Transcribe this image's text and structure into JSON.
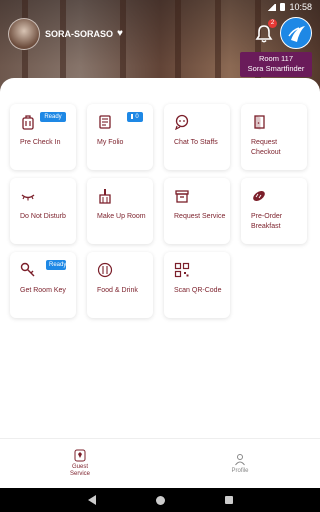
{
  "statusbar": {
    "time": "10:58"
  },
  "header": {
    "hotel_name": "SORA-SORASO",
    "notification_count": "2",
    "room_label": "Room 117",
    "room_sub": "Sora Smartfinder"
  },
  "services": [
    {
      "label": "Pre Check In",
      "icon": "luggage-icon",
      "badge": "Ready"
    },
    {
      "label": "My Folio",
      "icon": "receipt-icon",
      "badge": "0"
    },
    {
      "label": "Chat To Staffs",
      "icon": "chat-icon"
    },
    {
      "label": "Request Checkout",
      "icon": "door-icon"
    },
    {
      "label": "Do Not Disturb",
      "icon": "closed-eye-icon"
    },
    {
      "label": "Make Up Room",
      "icon": "broom-icon"
    },
    {
      "label": "Request Service",
      "icon": "service-box-icon"
    },
    {
      "label": "Pre-Order Breakfast",
      "icon": "bread-icon"
    },
    {
      "label": "Get Room Key",
      "icon": "key-icon",
      "badge": "Ready"
    },
    {
      "label": "Food & Drink",
      "icon": "cutlery-icon"
    },
    {
      "label": "Scan QR-Code",
      "icon": "qr-icon"
    }
  ],
  "bottom_nav": {
    "guest_service": "Guest Service",
    "profile": "Profile"
  },
  "colors": {
    "accent": "#7b1f2a",
    "badge": "#1e88e5",
    "room_tag": "#6a1b5a"
  }
}
